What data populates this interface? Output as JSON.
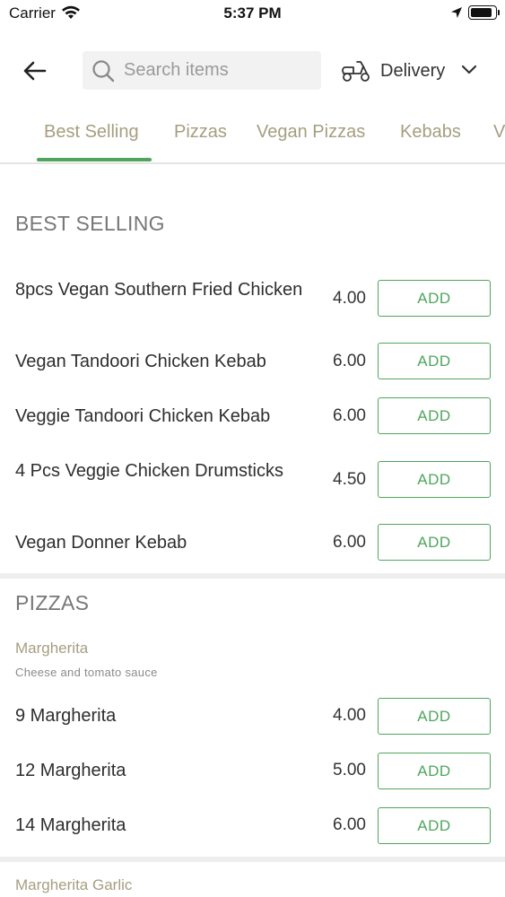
{
  "status_bar": {
    "carrier": "Carrier",
    "time": "5:37 PM",
    "battery_level": 0.9
  },
  "header": {
    "search_placeholder": "Search items",
    "delivery_label": "Delivery"
  },
  "tabs": [
    {
      "label": "Best Selling",
      "active": true
    },
    {
      "label": "Pizzas",
      "active": false
    },
    {
      "label": "Vegan Pizzas",
      "active": false
    },
    {
      "label": "Kebabs",
      "active": false
    },
    {
      "label": "V",
      "active": false
    }
  ],
  "sections": {
    "best_selling": {
      "title": "BEST SELLING",
      "items": [
        {
          "name": "8pcs Vegan Southern Fried Chicken",
          "price": "4.00",
          "button": "ADD"
        },
        {
          "name": "Vegan Tandoori Chicken Kebab",
          "price": "6.00",
          "button": "ADD"
        },
        {
          "name": "Veggie Tandoori Chicken Kebab",
          "price": "6.00",
          "button": "ADD"
        },
        {
          "name": "4 Pcs Veggie Chicken Drumsticks",
          "price": "4.50",
          "button": "ADD"
        },
        {
          "name": "Vegan Donner Kebab",
          "price": "6.00",
          "button": "ADD"
        }
      ]
    },
    "pizzas": {
      "title": "PIZZAS",
      "groups": [
        {
          "title": "Margherita",
          "description": "Cheese and tomato sauce",
          "items": [
            {
              "name": "9 Margherita",
              "price": "4.00",
              "button": "ADD"
            },
            {
              "name": "12 Margherita",
              "price": "5.00",
              "button": "ADD"
            },
            {
              "name": "14 Margherita",
              "price": "6.00",
              "button": "ADD"
            }
          ]
        },
        {
          "title": "Margherita Garlic"
        }
      ]
    }
  },
  "icons": {
    "back": "back-arrow-icon",
    "search": "search-icon",
    "delivery": "scooter-icon",
    "dropdown": "chevron-down-icon"
  },
  "colors": {
    "accent": "#4fa55e",
    "category_text": "#a59e80",
    "section_title": "#777777"
  }
}
